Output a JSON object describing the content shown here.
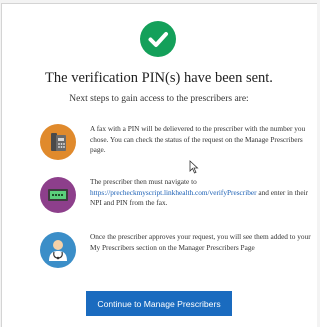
{
  "colors": {
    "success": "#14a05a",
    "button": "#1a6bbf",
    "link": "#1a5fb4"
  },
  "header": {
    "title": "The verification PIN(s) have been sent.",
    "subtitle": "Next steps to gain access to the prescribers are:"
  },
  "steps": [
    {
      "icon": "fax-machine-icon",
      "icon_color": "#e08a2c",
      "text": "A fax with a PIN will be delievered to the prescriber with the number you chose. You can check the status of the request on the Manage Prescribers page."
    },
    {
      "icon": "computer-monitor-icon",
      "icon_color": "#8d3f8b",
      "text_before": "The prescriber then must navigate to",
      "link": "https://precheckmyscript.linkhealth.com/verifyPrescriber",
      "text_after": " and enter in their NPI and PIN from the fax."
    },
    {
      "icon": "doctor-icon",
      "icon_color": "#3b8ec8",
      "text": "Once the prescriber approves your request, you will see them added to your My Prescribers section on the Manager Prescribers Page"
    }
  ],
  "actions": {
    "continue_label": "Continue to Manage Prescribers"
  }
}
